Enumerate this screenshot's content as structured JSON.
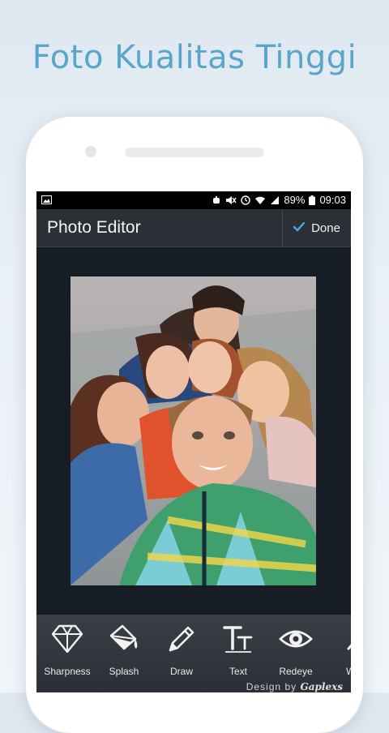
{
  "headline": "Foto Kualitas Tinggi",
  "status_bar": {
    "battery_percent": "89%",
    "time": "09:03",
    "icons": [
      "image-icon",
      "alarm-icon",
      "mute-vibrate-icon",
      "clock-icon",
      "wifi-icon",
      "signal-icon",
      "battery-icon"
    ]
  },
  "app_bar": {
    "title": "Photo Editor",
    "done_label": "Done",
    "done_icon": "check-icon"
  },
  "tools": [
    {
      "label": "Sharpness",
      "icon": "diamond-icon"
    },
    {
      "label": "Splash",
      "icon": "paint-bucket-icon"
    },
    {
      "label": "Draw",
      "icon": "pencil-icon"
    },
    {
      "label": "Text",
      "icon": "text-tt-icon"
    },
    {
      "label": "Redeye",
      "icon": "eye-icon"
    },
    {
      "label": "Wh",
      "icon": "whiten-icon"
    }
  ],
  "credit": {
    "prefix": "Design by",
    "brand": "Gaplexs"
  },
  "colors": {
    "headline": "#5aa6c9",
    "app_bar": "#2b3036",
    "editor_background": "#161d24",
    "toolbar": "#33383e",
    "done_check": "#4ea6e6"
  }
}
